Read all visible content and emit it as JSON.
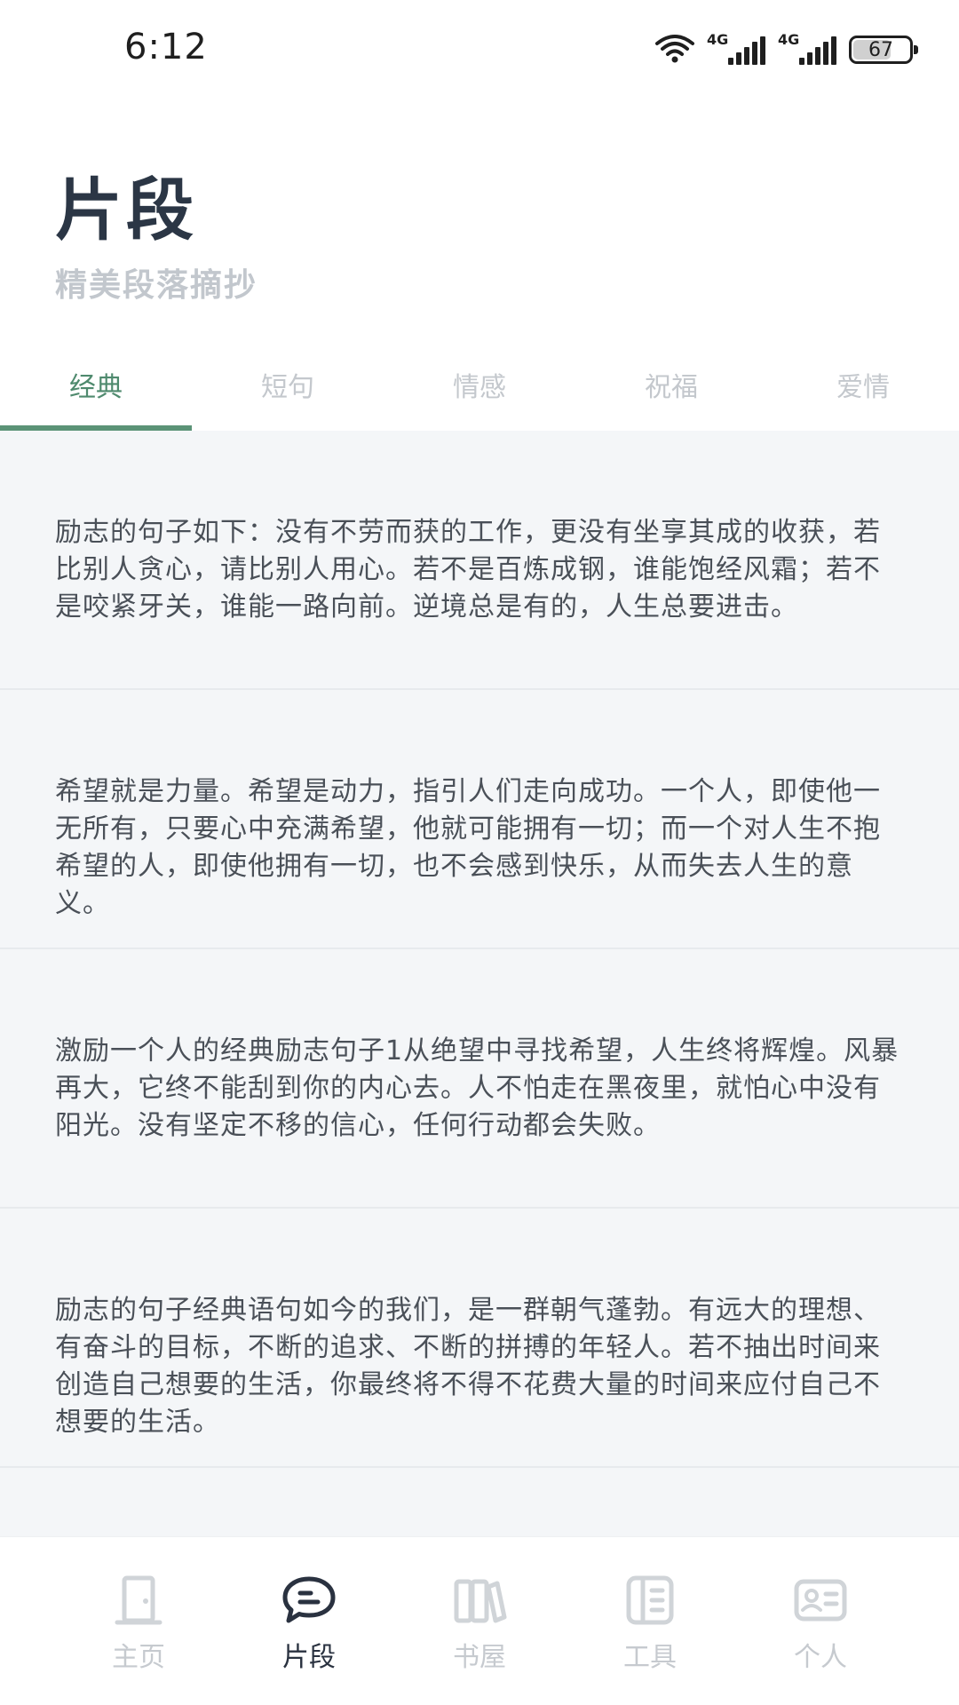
{
  "status_bar": {
    "time": "6:12",
    "network_1": "4G",
    "network_2": "4G",
    "battery_level": "67",
    "battery_fraction": 0.67,
    "icons": [
      "wifi-icon",
      "signal-icon",
      "signal-icon",
      "battery-icon"
    ]
  },
  "header": {
    "title": "片段",
    "subtitle": "精美段落摘抄"
  },
  "tabs": [
    {
      "label": "经典",
      "active": true
    },
    {
      "label": "短句",
      "active": false
    },
    {
      "label": "情感",
      "active": false
    },
    {
      "label": "祝福",
      "active": false
    },
    {
      "label": "爱情",
      "active": false
    }
  ],
  "articles": [
    {
      "text": "励志的句子如下：没有不劳而获的工作，更没有坐享其成的收获，若比别人贪心，请比别人用心。若不是百炼成钢，谁能饱经风霜；若不是咬紧牙关，谁能一路向前。逆境总是有的，人生总要进击。"
    },
    {
      "text": "希望就是力量。希望是动力，指引人们走向成功。一个人，即使他一无所有，只要心中充满希望，他就可能拥有一切；而一个对人生不抱希望的人，即使他拥有一切，也不会感到快乐，从而失去人生的意义。"
    },
    {
      "text": "激励一个人的经典励志句子1从绝望中寻找希望，人生终将辉煌。风暴再大，它终不能刮到你的内心去。人不怕走在黑夜里，就怕心中没有阳光。没有坚定不移的信心，任何行动都会失败。"
    },
    {
      "text": "励志的句子经典语句如今的我们，是一群朝气蓬勃。有远大的理想、有奋斗的目标，不断的追求、不断的拼搏的年轻人。若不抽出时间来创造自己想要的生活，你最终将不得不花费大量的时间来应付自己不想要的生活。"
    }
  ],
  "bottom_nav": [
    {
      "label": "主页",
      "icon": "door-icon",
      "active": false
    },
    {
      "label": "片段",
      "icon": "chat-bubble-icon",
      "active": true
    },
    {
      "label": "书屋",
      "icon": "books-icon",
      "active": false
    },
    {
      "label": "工具",
      "icon": "tools-icon",
      "active": false
    },
    {
      "label": "个人",
      "icon": "id-card-icon",
      "active": false
    }
  ],
  "colors": {
    "accent": "#5b9377",
    "title": "#2b3645",
    "inactive": "#c4c8cd",
    "list_bg": "#f4f6f8"
  }
}
